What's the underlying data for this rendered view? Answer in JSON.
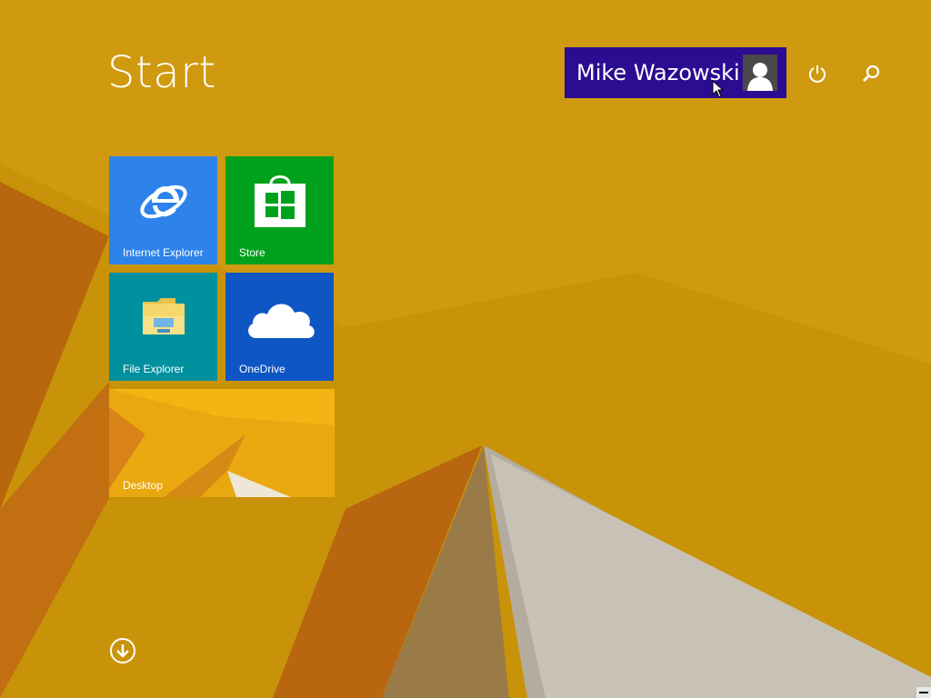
{
  "screen": {
    "title": "Start"
  },
  "user": {
    "name": "Mike Wazowski",
    "avatar_icon": "user-silhouette-icon"
  },
  "top_icons": [
    {
      "name": "power-icon"
    },
    {
      "name": "search-icon"
    }
  ],
  "tiles": [
    {
      "label": "Internet Explorer",
      "icon": "internet-explorer-icon",
      "color": "#2d83ea"
    },
    {
      "label": "Store",
      "icon": "store-icon",
      "color": "#00a21d"
    },
    {
      "label": "File Explorer",
      "icon": "folder-icon",
      "color": "#00909e"
    },
    {
      "label": "OneDrive",
      "icon": "cloud-icon",
      "color": "#0e56c4"
    },
    {
      "label": "Desktop",
      "icon": "desktop-wallpaper",
      "color": "#e9a80f"
    }
  ],
  "apps_button": {
    "icon": "down-arrow-icon"
  },
  "colors": {
    "background": "#c99309",
    "user_bar": "#2c0d91"
  }
}
